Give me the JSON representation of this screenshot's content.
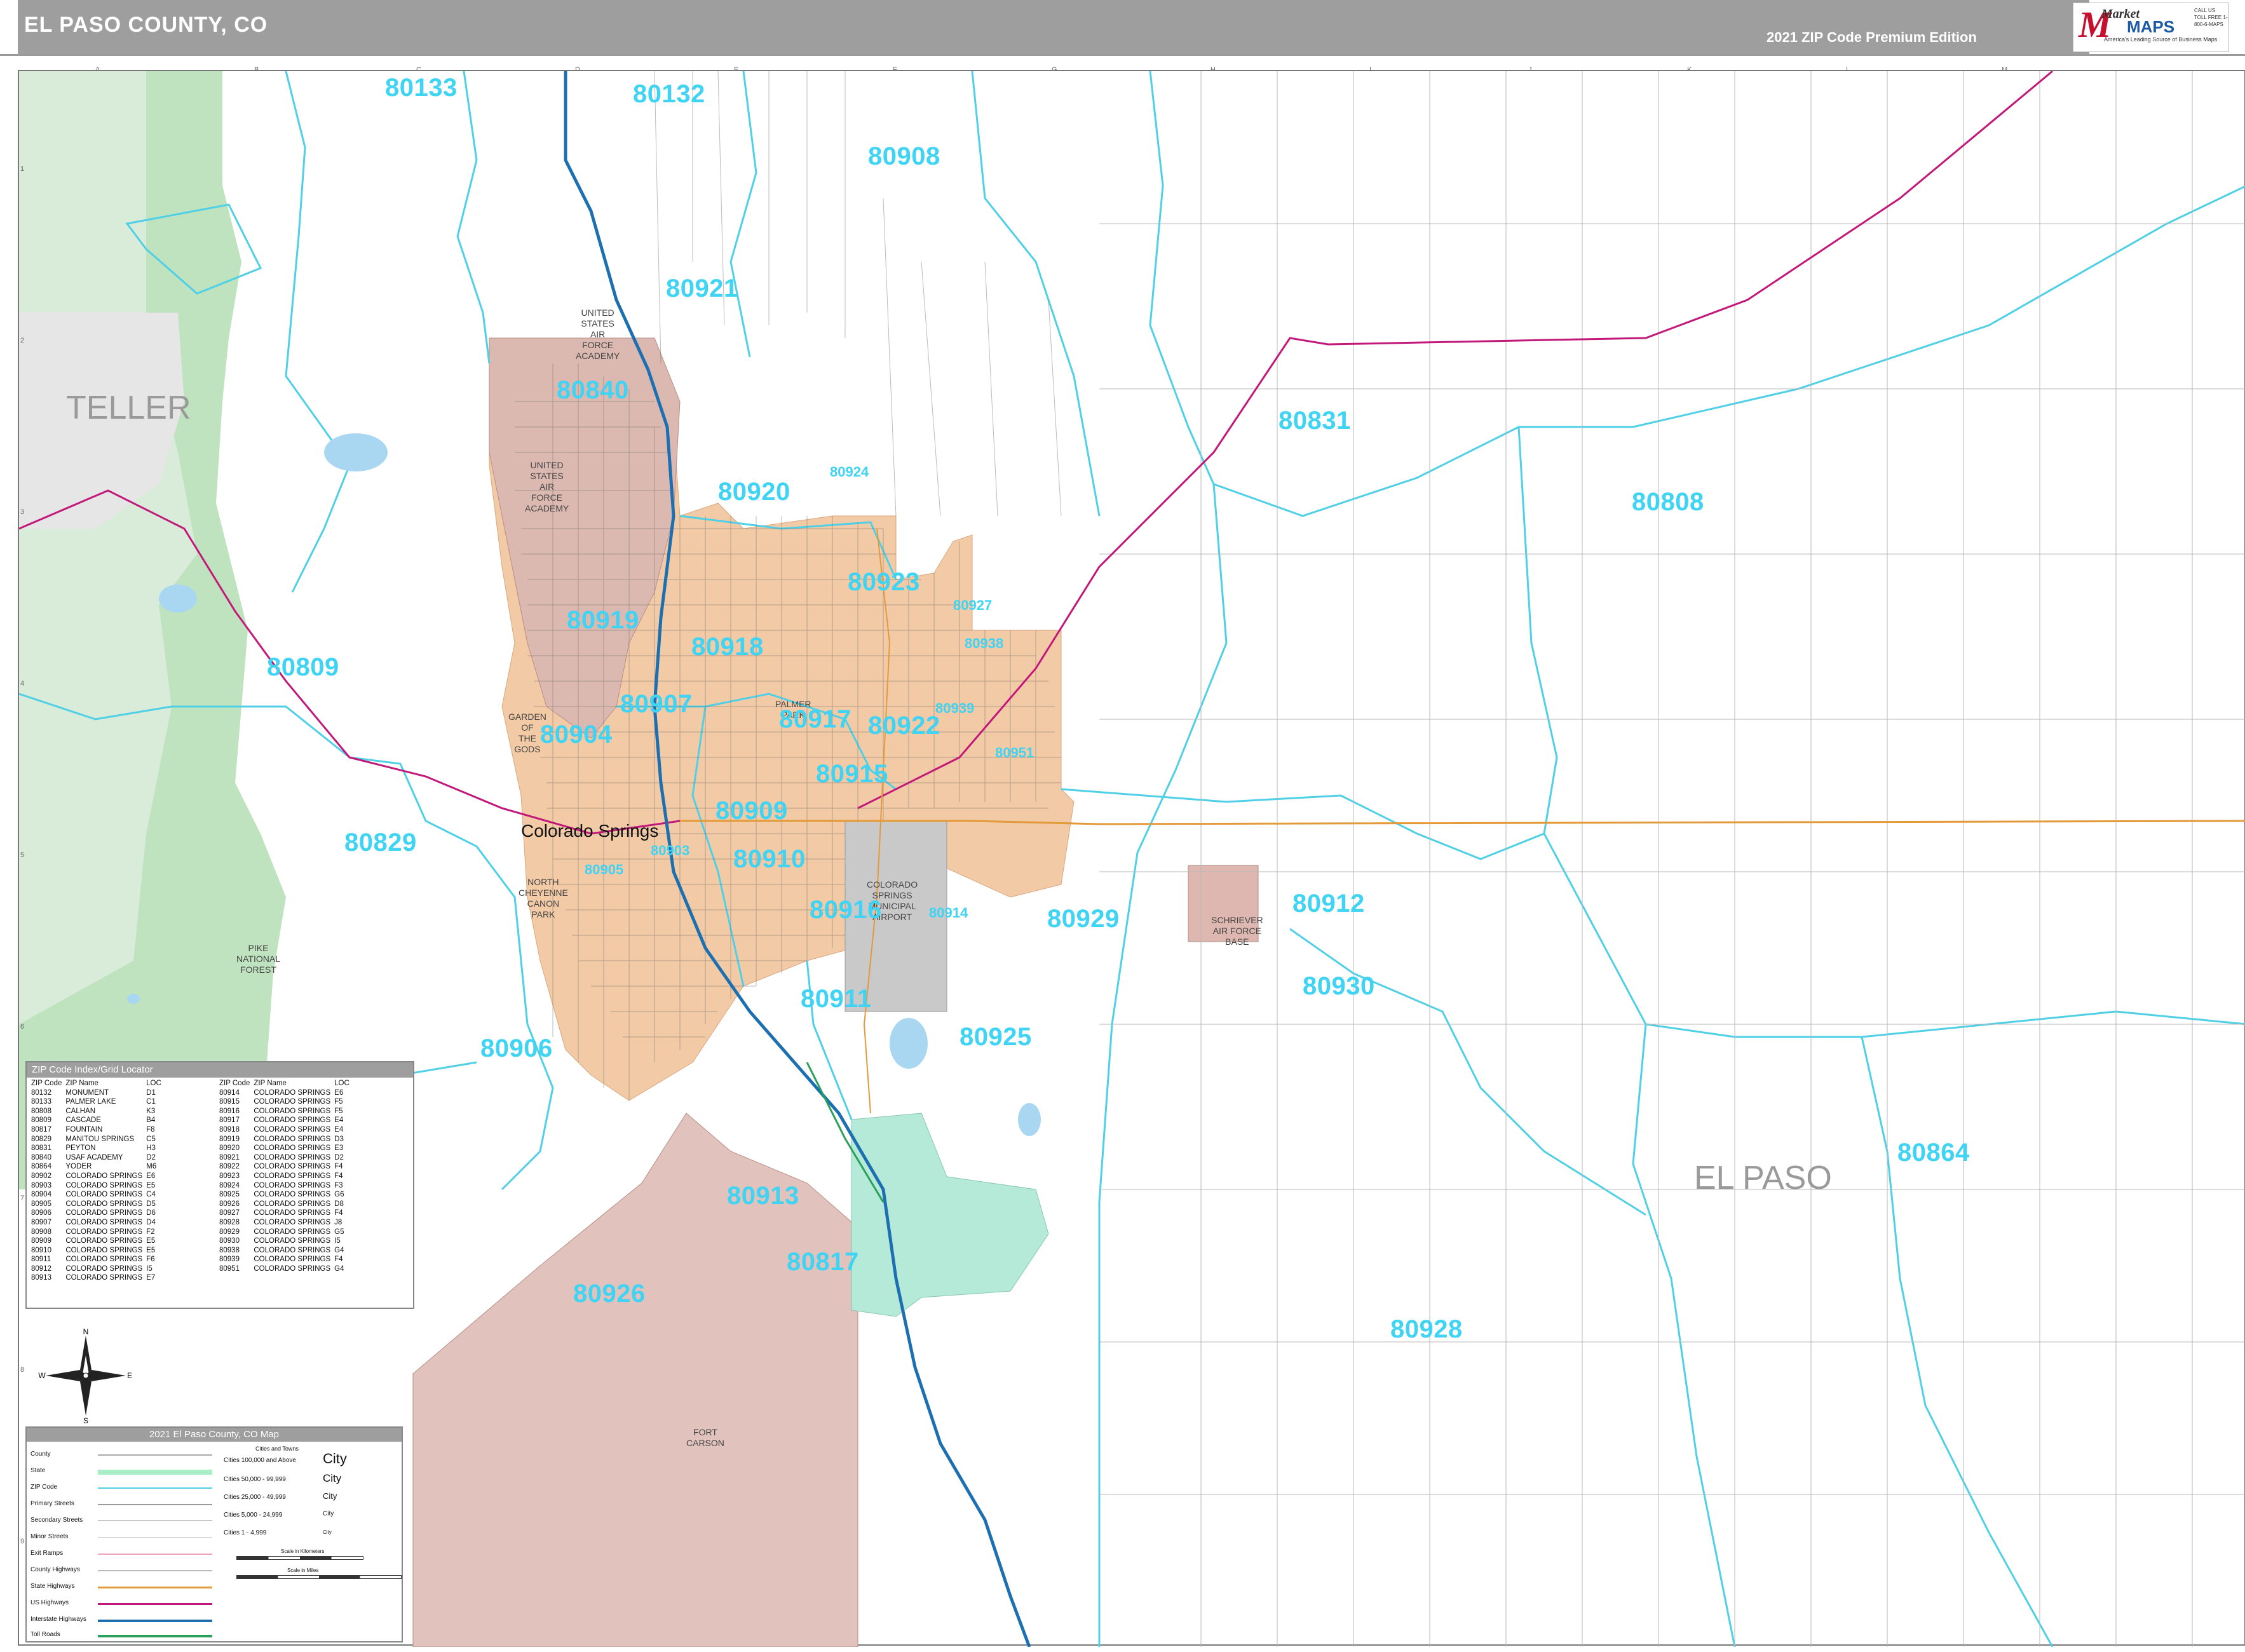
{
  "header": {
    "title": "EL PASO COUNTY, CO",
    "edition": "2021 ZIP Code Premium Edition",
    "logo_market": "Market",
    "logo_maps": "MAPS",
    "logo_tagline": "America's Leading Source of Business Maps",
    "logo_contact": "CALL US TOLL FREE 1-800-6-MAPS"
  },
  "grid": {
    "columns": [
      "A",
      "B",
      "C",
      "D",
      "E",
      "F",
      "G",
      "H",
      "I",
      "J",
      "K",
      "L",
      "M"
    ],
    "rows": [
      "1",
      "2",
      "3",
      "4",
      "5",
      "6",
      "7",
      "8",
      "9"
    ]
  },
  "counties": {
    "teller": "TELLER",
    "el_paso": "EL PASO"
  },
  "cities": {
    "colorado_springs": "Colorado Springs"
  },
  "areas": {
    "usaf_academy_1": "UNITED\nSTATES\nAIR\nFORCE\nACADEMY",
    "usaf_academy_2": "UNITED\nSTATES\nAIR\nFORCE\nACADEMY",
    "garden_of_gods": "GARDEN\nOF\nTHE\nGODS",
    "pike_forest": "PIKE\nNATIONAL\nFOREST",
    "airport": "COLORADO\nSPRINGS\nMUNICIPAL\nAIRPORT",
    "schriever": "SCHRIEVER\nAIR FORCE\nBASE",
    "fort_carson": "FORT\nCARSON",
    "palmer_park": "PALMER\nPARK",
    "cheyenne_canon": "NORTH\nCHEYENNE\nCANON\nPARK"
  },
  "zips": {
    "z80133": "80133",
    "z80132": "80132",
    "z80908": "80908",
    "z80921": "80921",
    "z80840": "80840",
    "z80831": "80831",
    "z80808": "80808",
    "z80920": "80920",
    "z80924": "80924",
    "z80923": "80923",
    "z80927": "80927",
    "z80919": "80919",
    "z80918": "80918",
    "z80938": "80938",
    "z80809": "80809",
    "z80907": "80907",
    "z80917": "80917",
    "z80922": "80922",
    "z80939": "80939",
    "z80904": "80904",
    "z80951": "80951",
    "z80915": "80915",
    "z80909": "80909",
    "z80829": "80829",
    "z80903": "80903",
    "z80910": "80910",
    "z80905": "80905",
    "z80916": "80916",
    "z80914": "80914",
    "z80929": "80929",
    "z80912": "80912",
    "z80930": "80930",
    "z80911": "80911",
    "z80925": "80925",
    "z80906": "80906",
    "z80864": "80864",
    "z80913": "80913",
    "z80817": "80817",
    "z80926": "80926",
    "z80928": "80928"
  },
  "zip_index": {
    "title": "ZIP Code Index/Grid Locator",
    "headers": [
      "ZIP Code",
      "ZIP Name",
      "LOC",
      "ZIP Code",
      "ZIP Name",
      "LOC"
    ],
    "left": [
      [
        "80132",
        "MONUMENT",
        "D1"
      ],
      [
        "80133",
        "PALMER LAKE",
        "C1"
      ],
      [
        "80808",
        "CALHAN",
        "K3"
      ],
      [
        "80809",
        "CASCADE",
        "B4"
      ],
      [
        "80817",
        "FOUNTAIN",
        "F8"
      ],
      [
        "80829",
        "MANITOU SPRINGS",
        "C5"
      ],
      [
        "80831",
        "PEYTON",
        "H3"
      ],
      [
        "80840",
        "USAF ACADEMY",
        "D2"
      ],
      [
        "80864",
        "YODER",
        "M6"
      ],
      [
        "80902",
        "COLORADO SPRINGS",
        "E6"
      ],
      [
        "80903",
        "COLORADO SPRINGS",
        "E5"
      ],
      [
        "80904",
        "COLORADO SPRINGS",
        "C4"
      ],
      [
        "80905",
        "COLORADO SPRINGS",
        "D5"
      ],
      [
        "80906",
        "COLORADO SPRINGS",
        "D6"
      ],
      [
        "80907",
        "COLORADO SPRINGS",
        "D4"
      ],
      [
        "80908",
        "COLORADO SPRINGS",
        "F2"
      ],
      [
        "80909",
        "COLORADO SPRINGS",
        "E5"
      ],
      [
        "80910",
        "COLORADO SPRINGS",
        "E5"
      ],
      [
        "80911",
        "COLORADO SPRINGS",
        "F6"
      ],
      [
        "80912",
        "COLORADO SPRINGS",
        "I5"
      ],
      [
        "80913",
        "COLORADO SPRINGS",
        "E7"
      ]
    ],
    "right": [
      [
        "80914",
        "COLORADO SPRINGS",
        "E6"
      ],
      [
        "80915",
        "COLORADO SPRINGS",
        "F5"
      ],
      [
        "80916",
        "COLORADO SPRINGS",
        "F5"
      ],
      [
        "80917",
        "COLORADO SPRINGS",
        "E4"
      ],
      [
        "80918",
        "COLORADO SPRINGS",
        "E4"
      ],
      [
        "80919",
        "COLORADO SPRINGS",
        "D3"
      ],
      [
        "80920",
        "COLORADO SPRINGS",
        "E3"
      ],
      [
        "80921",
        "COLORADO SPRINGS",
        "D2"
      ],
      [
        "80922",
        "COLORADO SPRINGS",
        "F4"
      ],
      [
        "80923",
        "COLORADO SPRINGS",
        "F4"
      ],
      [
        "80924",
        "COLORADO SPRINGS",
        "F3"
      ],
      [
        "80925",
        "COLORADO SPRINGS",
        "G6"
      ],
      [
        "80926",
        "COLORADO SPRINGS",
        "D8"
      ],
      [
        "80927",
        "COLORADO SPRINGS",
        "F4"
      ],
      [
        "80928",
        "COLORADO SPRINGS",
        "J8"
      ],
      [
        "80929",
        "COLORADO SPRINGS",
        "G5"
      ],
      [
        "80930",
        "COLORADO SPRINGS",
        "I5"
      ],
      [
        "80938",
        "COLORADO SPRINGS",
        "G4"
      ],
      [
        "80939",
        "COLORADO SPRINGS",
        "F4"
      ],
      [
        "80951",
        "COLORADO SPRINGS",
        "G4"
      ]
    ]
  },
  "compass": {
    "n": "N",
    "s": "S",
    "e": "E",
    "w": "W"
  },
  "legend": {
    "title": "2021 El Paso County, CO Map",
    "rows": [
      "County",
      "State",
      "ZIP Code",
      "Primary Streets",
      "Secondary Streets",
      "Minor Streets",
      "Exit Ramps",
      "County Highways",
      "State Highways",
      "US Highways",
      "Interstate Highways",
      "Toll Roads"
    ],
    "cities_header": "Cities and Towns",
    "cities": [
      {
        "label": "Cities 100,000 and Above",
        "sample": "City"
      },
      {
        "label": "Cities 50,000 - 99,999",
        "sample": "City"
      },
      {
        "label": "Cities 25,000 - 49,999",
        "sample": "City"
      },
      {
        "label": "Cities 5,000 - 24,999",
        "sample": "City"
      },
      {
        "label": "Cities 1 - 4,999",
        "sample": "City"
      }
    ],
    "scale_km": "Scale in Kilometers",
    "scale_mi": "Scale in Miles"
  },
  "colors": {
    "zip_label": "#3fd3f4",
    "zip_boundary": "#4fd0e6",
    "national_forest": "#a8d5a8",
    "urban": "#f3caa6",
    "military": "#d9b5ae",
    "interstate": "#1c6fb0",
    "us_highway": "#c2187a",
    "title_bar": "#9e9e9e"
  }
}
